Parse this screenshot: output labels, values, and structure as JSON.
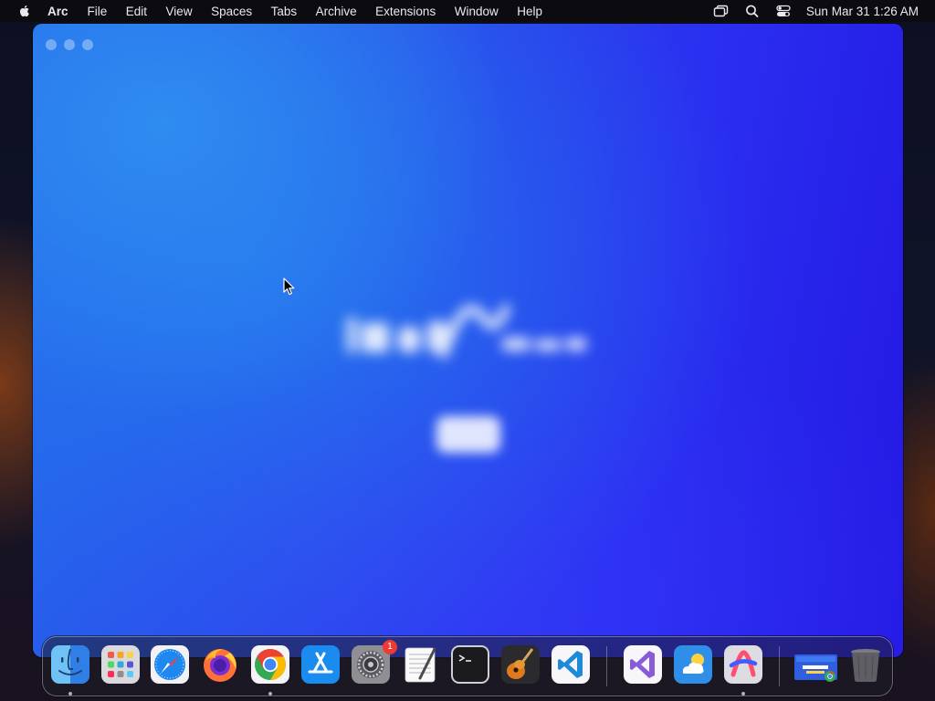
{
  "menubar": {
    "app_name": "Arc",
    "items": [
      "File",
      "Edit",
      "View",
      "Spaces",
      "Tabs",
      "Archive",
      "Extensions",
      "Window",
      "Help"
    ],
    "clock": "Sun Mar 31  1:26 AM",
    "status_icons": [
      "screen-mirroring-icon",
      "spotlight-search-icon",
      "control-center-icon"
    ]
  },
  "arc_window": {
    "state": "loading splash",
    "traffic_lights": [
      "close",
      "minimize",
      "zoom"
    ]
  },
  "dock": {
    "apps": [
      {
        "name": "Finder",
        "icon": "finder-icon",
        "running": true
      },
      {
        "name": "Launchpad",
        "icon": "launchpad-icon",
        "running": false
      },
      {
        "name": "Safari",
        "icon": "safari-icon",
        "running": false
      },
      {
        "name": "Firefox",
        "icon": "firefox-icon",
        "running": false
      },
      {
        "name": "Google Chrome",
        "icon": "chrome-icon",
        "running": true
      },
      {
        "name": "App Store",
        "icon": "app-store-icon",
        "running": false
      },
      {
        "name": "System Settings",
        "icon": "system-settings-icon",
        "running": false,
        "badge": "1"
      },
      {
        "name": "TextEdit",
        "icon": "textedit-icon",
        "running": false
      },
      {
        "name": "Terminal",
        "icon": "terminal-icon",
        "running": false
      },
      {
        "name": "GarageBand",
        "icon": "garageband-icon",
        "running": false
      },
      {
        "name": "Visual Studio Code",
        "icon": "vscode-icon",
        "running": false
      },
      {
        "name": "Visual Studio",
        "icon": "visual-studio-icon",
        "running": false
      },
      {
        "name": "Weather",
        "icon": "weather-icon",
        "running": false
      },
      {
        "name": "Arc",
        "icon": "arc-icon",
        "running": true
      }
    ],
    "recent": [
      {
        "name": "Chrome web app",
        "icon": "chrome-webapp-icon"
      },
      {
        "name": "Trash",
        "icon": "trash-icon"
      }
    ]
  },
  "colors": {
    "arc_window_left": "#2f8cf0",
    "arc_window_right": "#2418e4",
    "menubar_bg": "#0b0b10",
    "badge_red": "#ec3b35"
  }
}
